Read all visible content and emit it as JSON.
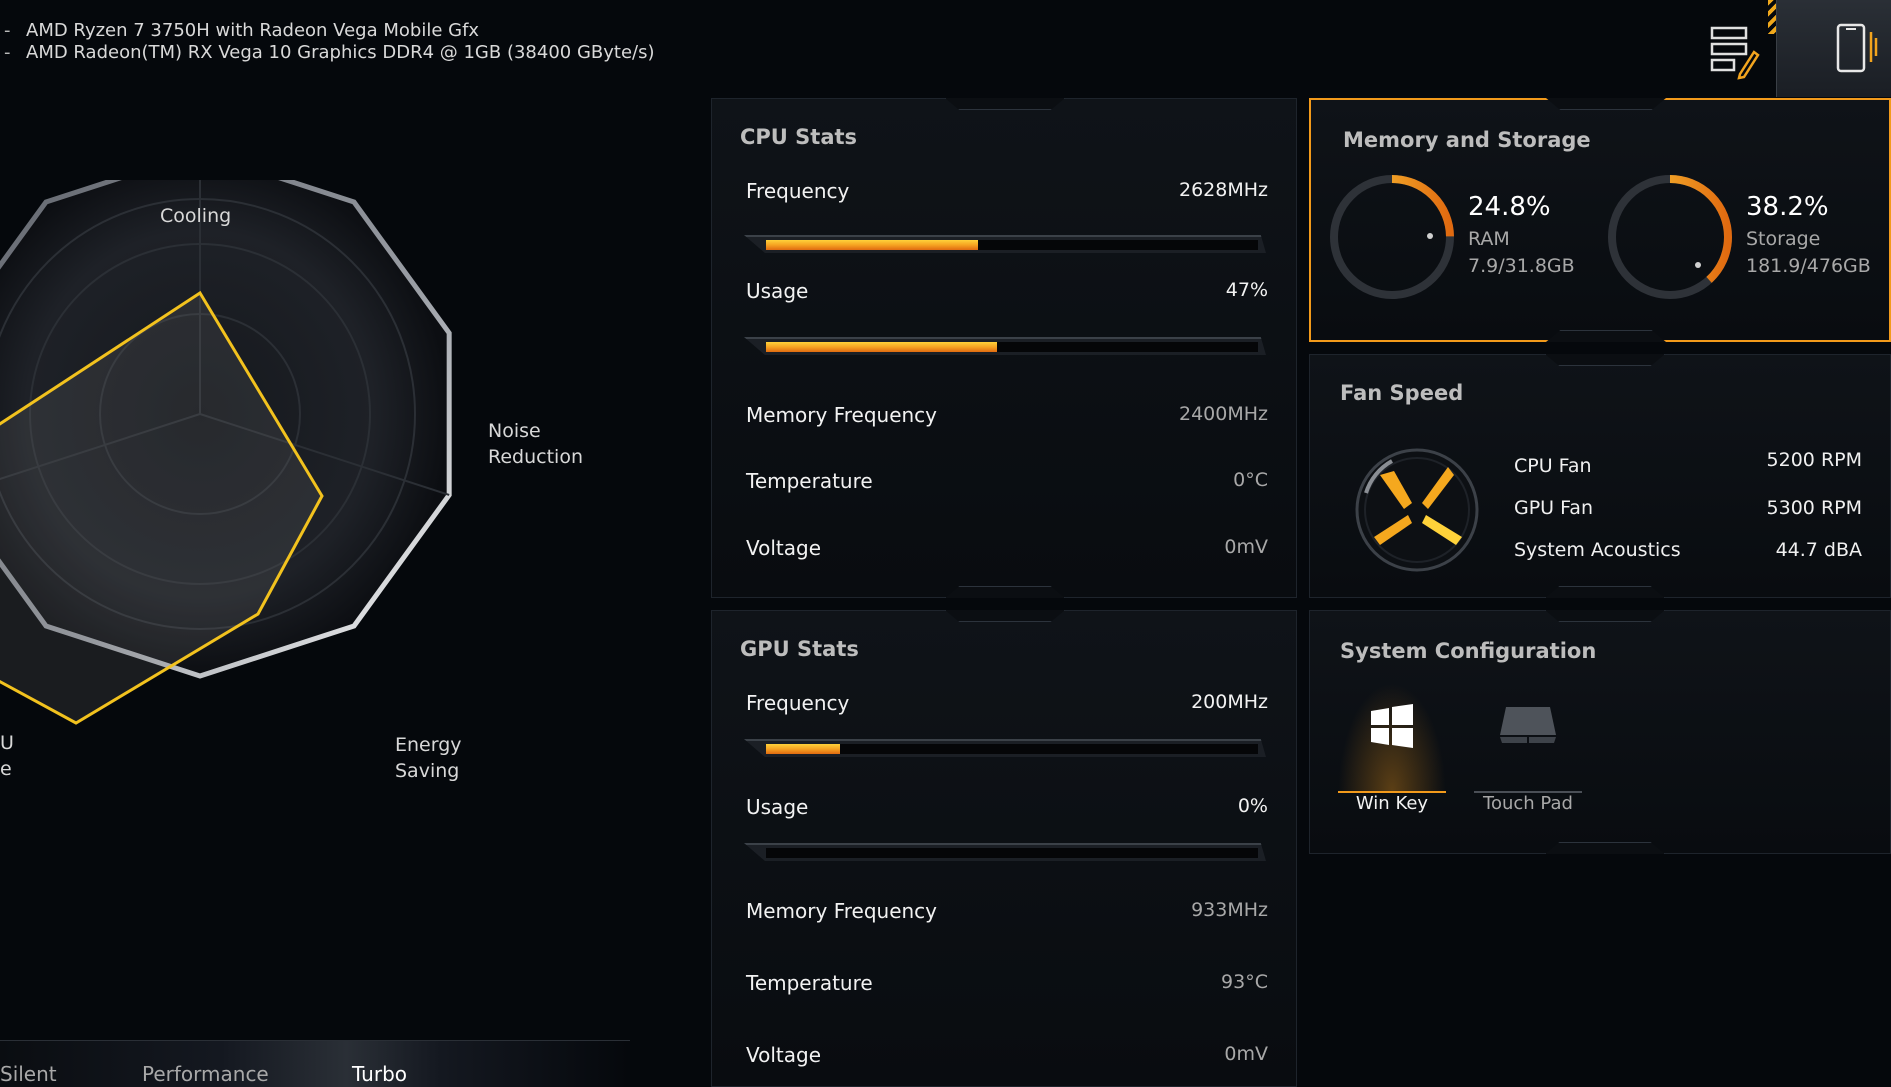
{
  "system": {
    "lines": [
      "AMD Ryzen 7 3750H with Radeon Vega Mobile Gfx",
      "AMD Radeon(TM) RX Vega 10 Graphics DDR4 @ 1GB (38400 GByte/s)"
    ]
  },
  "radar": {
    "labels": {
      "cooling": "Cooling",
      "noise_1": "Noise",
      "noise_2": "Reduction",
      "energy_1": "Energy",
      "energy_2": "Saving",
      "cut_1": "U",
      "cut_2": "e"
    }
  },
  "modes": {
    "silent": "Silent",
    "performance": "Performance",
    "turbo": "Turbo",
    "active": "Turbo"
  },
  "cpu": {
    "title": "CPU Stats",
    "frequency_label": "Frequency",
    "frequency_value": "2628MHz",
    "frequency_fill": 0.43,
    "usage_label": "Usage",
    "usage_value": "47%",
    "usage_fill": 0.47,
    "mem_freq_label": "Memory Frequency",
    "mem_freq_value": "2400MHz",
    "temp_label": "Temperature",
    "temp_value": "0°C",
    "voltage_label": "Voltage",
    "voltage_value": "0mV"
  },
  "gpu": {
    "title": "GPU Stats",
    "frequency_label": "Frequency",
    "frequency_value": "200MHz",
    "frequency_fill": 0.15,
    "usage_label": "Usage",
    "usage_value": "0%",
    "usage_fill": 0.0,
    "mem_freq_label": "Memory Frequency",
    "mem_freq_value": "933MHz",
    "temp_label": "Temperature",
    "temp_value": "93°C",
    "voltage_label": "Voltage",
    "voltage_value": "0mV"
  },
  "memory": {
    "title": "Memory and Storage",
    "ram_pct": "24.8%",
    "ram_fraction": 0.248,
    "ram_label": "RAM",
    "ram_amount": "7.9/31.8GB",
    "storage_pct": "38.2%",
    "storage_fraction": 0.382,
    "storage_label": "Storage",
    "storage_amount": "181.9/476GB"
  },
  "fan": {
    "title": "Fan Speed",
    "cpu_label": "CPU Fan",
    "cpu_value": "5200 RPM",
    "gpu_label": "GPU Fan",
    "gpu_value": "5300 RPM",
    "acoustic_label": "System Acoustics",
    "acoustic_value": "44.7 dBA"
  },
  "config": {
    "title": "System Configuration",
    "win_key": "Win Key",
    "touch_pad": "Touch Pad"
  },
  "colors": {
    "accent": "#f29a1b",
    "accent_yellow": "#ffd23a",
    "panel_border": "#1e242c"
  }
}
